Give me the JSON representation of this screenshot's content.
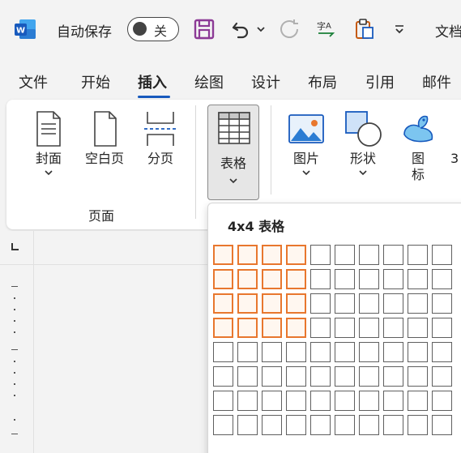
{
  "titlebar": {
    "autosave_label": "自动保存",
    "autosave_toggle": "关",
    "doc_title": "文档"
  },
  "tabs": [
    {
      "label": "文件",
      "active": false
    },
    {
      "label": "开始",
      "active": false
    },
    {
      "label": "插入",
      "active": true
    },
    {
      "label": "绘图",
      "active": false
    },
    {
      "label": "设计",
      "active": false
    },
    {
      "label": "布局",
      "active": false
    },
    {
      "label": "引用",
      "active": false
    },
    {
      "label": "邮件",
      "active": false
    }
  ],
  "ribbon": {
    "pages_group": {
      "label": "页面",
      "buttons": [
        {
          "label": "封面",
          "icon": "cover-page-icon",
          "has_dropdown": true
        },
        {
          "label": "空白页",
          "icon": "blank-page-icon",
          "has_dropdown": false
        },
        {
          "label": "分页",
          "icon": "page-break-icon",
          "has_dropdown": false
        }
      ]
    },
    "table_button": {
      "label": "表格",
      "icon": "table-icon",
      "has_dropdown": true
    },
    "illustrations": [
      {
        "label": "图片",
        "icon": "picture-icon",
        "has_dropdown": true
      },
      {
        "label": "形状",
        "icon": "shapes-icon",
        "has_dropdown": true
      },
      {
        "label": "图标",
        "icon": "icons-icon",
        "has_dropdown": false
      },
      {
        "label": "3",
        "icon": "3d-models-icon",
        "has_dropdown": false
      }
    ]
  },
  "table_dropdown": {
    "title": "4x4 表格",
    "grid_cols": 10,
    "grid_rows": 8,
    "selected_cols": 4,
    "selected_rows": 4
  },
  "colors": {
    "accent": "#185abd",
    "selection": "#e8772e",
    "word_blue": "#185abd",
    "save_purple": "#8c3a96"
  }
}
